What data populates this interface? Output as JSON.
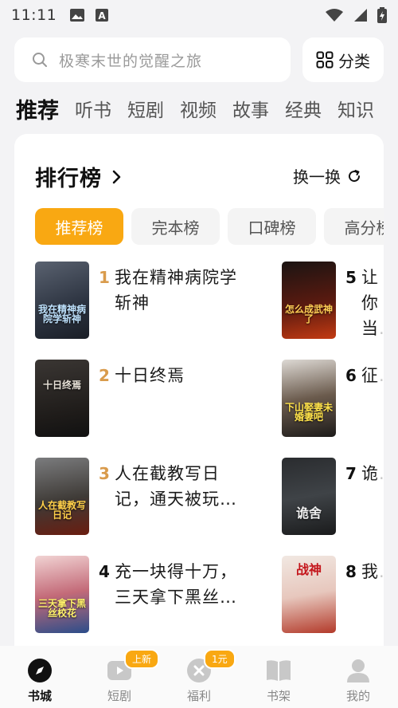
{
  "status_bar": {
    "time": "11:11"
  },
  "search": {
    "placeholder": "极寒末世的觉醒之旅"
  },
  "category_button": {
    "label": "分类",
    "icon": "grid-icon"
  },
  "top_tabs": [
    "推荐",
    "听书",
    "短剧",
    "视频",
    "故事",
    "经典",
    "知识"
  ],
  "ranking": {
    "title": "排行榜",
    "refresh_label": "换一换",
    "tabs": [
      "推荐榜",
      "完本榜",
      "口碑榜",
      "高分榜"
    ],
    "books": [
      {
        "rank": "1",
        "title": "我在精神病院学斩神",
        "cover_text": "我在精神病院学斩神"
      },
      {
        "rank": "2",
        "title": "十日终焉",
        "cover_text": "十日终焉"
      },
      {
        "rank": "3",
        "title": "人在截教写日记，通天被玩…",
        "cover_text": "人在截教写日记"
      },
      {
        "rank": "4",
        "title": "充一块得十万，三天拿下黑丝…",
        "cover_text": "三天拿下黑丝校花"
      },
      {
        "rank": "5",
        "title": "让你当…",
        "cover_text": "怎么成武神了"
      },
      {
        "rank": "6",
        "title": "征…",
        "cover_text": "下山娶妻未婚妻吧"
      },
      {
        "rank": "7",
        "title": "诡…",
        "cover_text": "诡舍"
      },
      {
        "rank": "8",
        "title": "我…",
        "cover_text": "战神"
      }
    ]
  },
  "bottom_nav": [
    {
      "label": "书城",
      "icon": "compass-icon",
      "badge": ""
    },
    {
      "label": "短剧",
      "icon": "video-play-icon",
      "badge": "上新"
    },
    {
      "label": "福利",
      "icon": "coin-icon",
      "badge": "1元"
    },
    {
      "label": "书架",
      "icon": "book-open-icon",
      "badge": ""
    },
    {
      "label": "我的",
      "icon": "person-icon",
      "badge": ""
    }
  ],
  "colors": {
    "accent": "#f9a812",
    "rank_top": "#d99b4c",
    "background": "#f3f3f5"
  }
}
